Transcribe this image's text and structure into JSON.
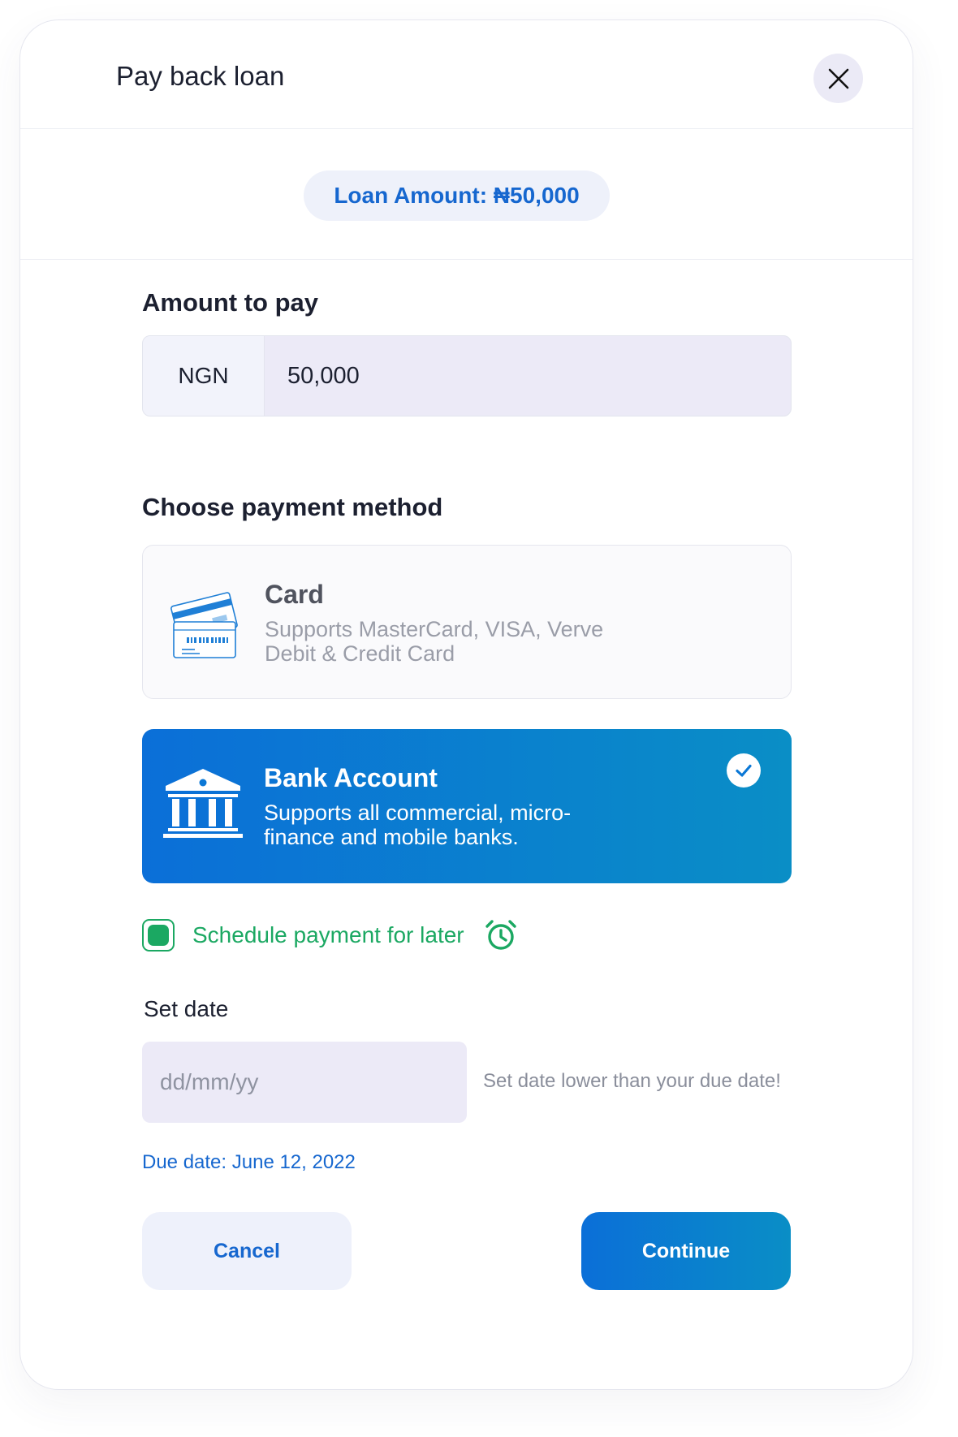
{
  "header": {
    "title": "Pay back loan"
  },
  "loan": {
    "amount_label": "Loan Amount: ₦50,000"
  },
  "amount_section": {
    "label": "Amount to pay",
    "currency": "NGN",
    "value": "50,000"
  },
  "payment_methods": {
    "label": "Choose payment method",
    "items": [
      {
        "title": "Card",
        "desc_line1": "Supports MasterCard, VISA, Verve",
        "desc_line2": "Debit & Credit Card",
        "selected": false,
        "icon": "credit-card-icon"
      },
      {
        "title": "Bank Account",
        "desc_line1": "Supports all commercial, micro-",
        "desc_line2": "finance and mobile banks.",
        "selected": true,
        "icon": "bank-icon"
      }
    ]
  },
  "schedule": {
    "label": "Schedule payment for later",
    "checked": true,
    "icon": "alarm-clock-icon"
  },
  "date": {
    "label": "Set date",
    "placeholder": "dd/mm/yy",
    "hint": "Set date lower than your due date!",
    "due_date": "Due date: June 12, 2022",
    "icon": "calendar-icon"
  },
  "actions": {
    "cancel_label": "Cancel",
    "continue_label": "Continue"
  },
  "colors": {
    "primary": "#1667cf",
    "gradient_start": "#0b6fd8",
    "gradient_end": "#0a8ec6",
    "success": "#1ba862",
    "field_bg": "#eceaf7"
  }
}
